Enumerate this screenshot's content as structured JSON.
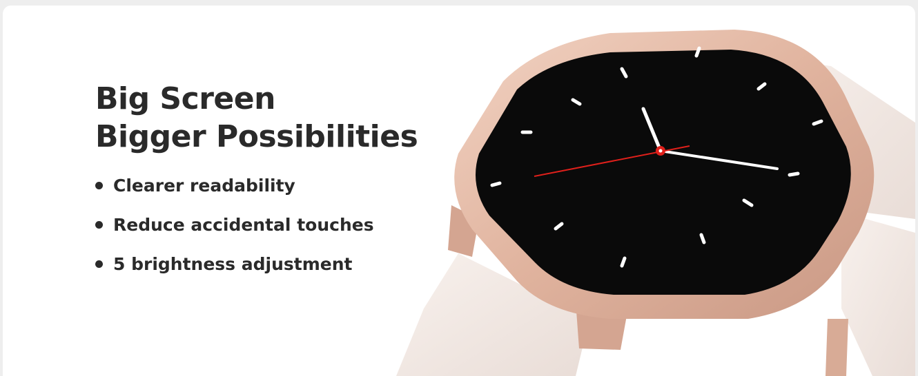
{
  "banner": {
    "headline": [
      "Big Screen",
      "Bigger Possibilities"
    ],
    "features": [
      "Clearer readability",
      "Reduce accidental touches",
      "5 brightness adjustment"
    ]
  },
  "product_image": {
    "subject": "smartwatch-rose-gold",
    "colors": {
      "case": "#e3b9a5",
      "strap": "#f1e7e2",
      "screen": "#0a0a0a",
      "second_hand": "#e0201b"
    }
  }
}
